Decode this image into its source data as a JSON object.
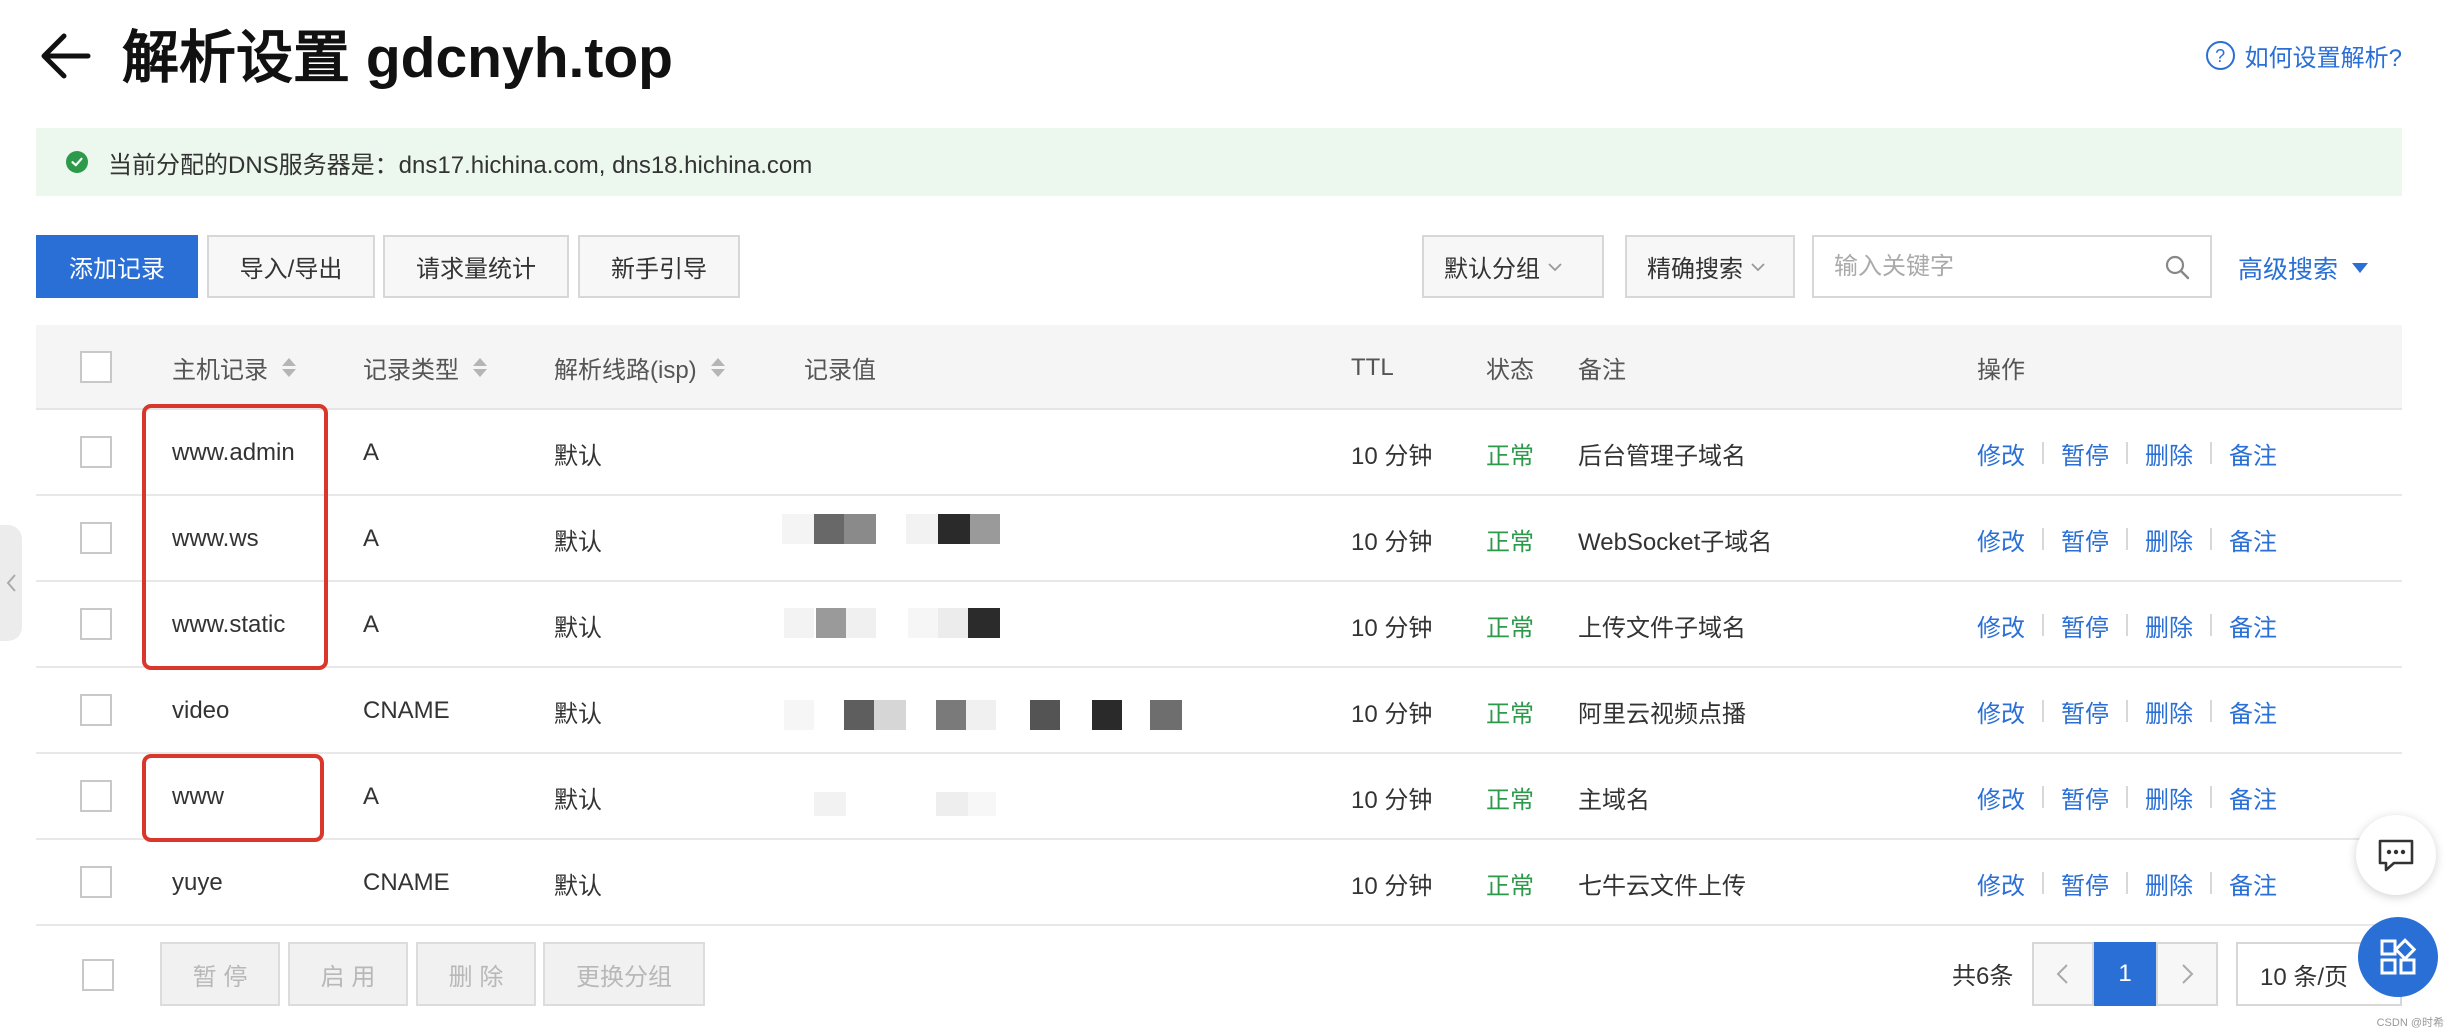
{
  "header": {
    "title": "解析设置 gdcnyh.top",
    "help_link": "如何设置解析?"
  },
  "notice": {
    "text": "当前分配的DNS服务器是：dns17.hichina.com, dns18.hichina.com"
  },
  "toolbar": {
    "add_record": "添加记录",
    "import_export": "导入/导出",
    "request_stats": "请求量统计",
    "beginner_guide": "新手引导",
    "group_select": "默认分组",
    "search_mode": "精确搜索",
    "search_placeholder": "输入关键字",
    "search_value": "",
    "advanced_search": "高级搜索"
  },
  "table": {
    "columns": {
      "host": "主机记录",
      "type": "记录类型",
      "line": "解析线路(isp)",
      "value": "记录值",
      "ttl": "TTL",
      "status": "状态",
      "remark": "备注",
      "actions": "操作"
    },
    "action_labels": {
      "edit": "修改",
      "pause": "暂停",
      "delete": "删除",
      "remark": "备注"
    },
    "rows": [
      {
        "host": "www.admin",
        "type": "A",
        "line": "默认",
        "ttl": "10 分钟",
        "status": "正常",
        "remark": "后台管理子域名"
      },
      {
        "host": "www.ws",
        "type": "A",
        "line": "默认",
        "ttl": "10 分钟",
        "status": "正常",
        "remark": "WebSocket子域名"
      },
      {
        "host": "www.static",
        "type": "A",
        "line": "默认",
        "ttl": "10 分钟",
        "status": "正常",
        "remark": "上传文件子域名"
      },
      {
        "host": "video",
        "type": "CNAME",
        "line": "默认",
        "ttl": "10 分钟",
        "status": "正常",
        "remark": "阿里云视频点播"
      },
      {
        "host": "www",
        "type": "A",
        "line": "默认",
        "ttl": "10 分钟",
        "status": "正常",
        "remark": "主域名"
      },
      {
        "host": "yuye",
        "type": "CNAME",
        "line": "默认",
        "ttl": "10 分钟",
        "status": "正常",
        "remark": "七牛云文件上传"
      }
    ]
  },
  "bulk_actions": {
    "pause": "暂 停",
    "enable": "启 用",
    "delete": "删 除",
    "change_group": "更换分组"
  },
  "pagination": {
    "total": "共6条",
    "current_page": "1",
    "page_size": "10 条/页"
  },
  "watermark": "CSDN @时希",
  "colors": {
    "accent": "#2a6fd6",
    "status_ok": "#2c9a4a",
    "highlight_box": "#d9372b",
    "notice_bg": "#ecf7ee"
  },
  "icons": {
    "back": "arrow-left-icon",
    "help": "question-circle-icon",
    "notice": "check-circle-icon",
    "search": "search-icon",
    "chat": "chat-icon",
    "apps": "apps-grid-icon"
  }
}
